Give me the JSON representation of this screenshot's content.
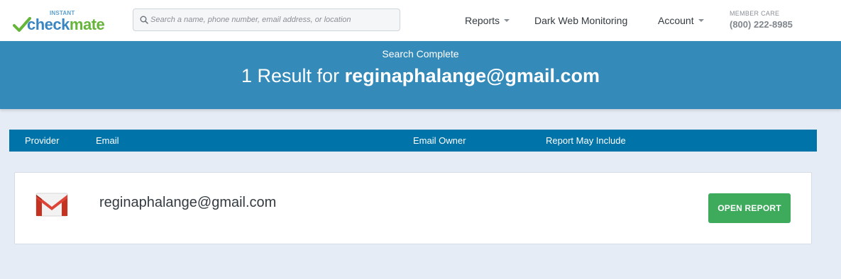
{
  "header": {
    "logo": {
      "small_text": "INSTANT",
      "word_part1": "check",
      "word_part2": "mate"
    },
    "search": {
      "placeholder": "Search a name, phone number, email address, or location",
      "value": ""
    },
    "nav": {
      "reports": "Reports",
      "dark_web": "Dark Web Monitoring",
      "account": "Account"
    },
    "member_care": {
      "label": "MEMBER CARE",
      "phone": "(800) 222-8985"
    }
  },
  "hero": {
    "subtitle": "Search Complete",
    "title_prefix": "1 Result for ",
    "query": "reginaphalange@gmail.com"
  },
  "table": {
    "columns": [
      "Provider",
      "Email",
      "Email Owner",
      "Report May Include"
    ]
  },
  "results": [
    {
      "provider_icon": "gmail-icon",
      "email": "reginaphalange@gmail.com",
      "button_label": "OPEN REPORT"
    }
  ],
  "colors": {
    "hero_bg": "#348ab9",
    "table_header_bg": "#0073a8",
    "button_green": "#3eaa5c",
    "page_bg": "#e6ecf5"
  }
}
